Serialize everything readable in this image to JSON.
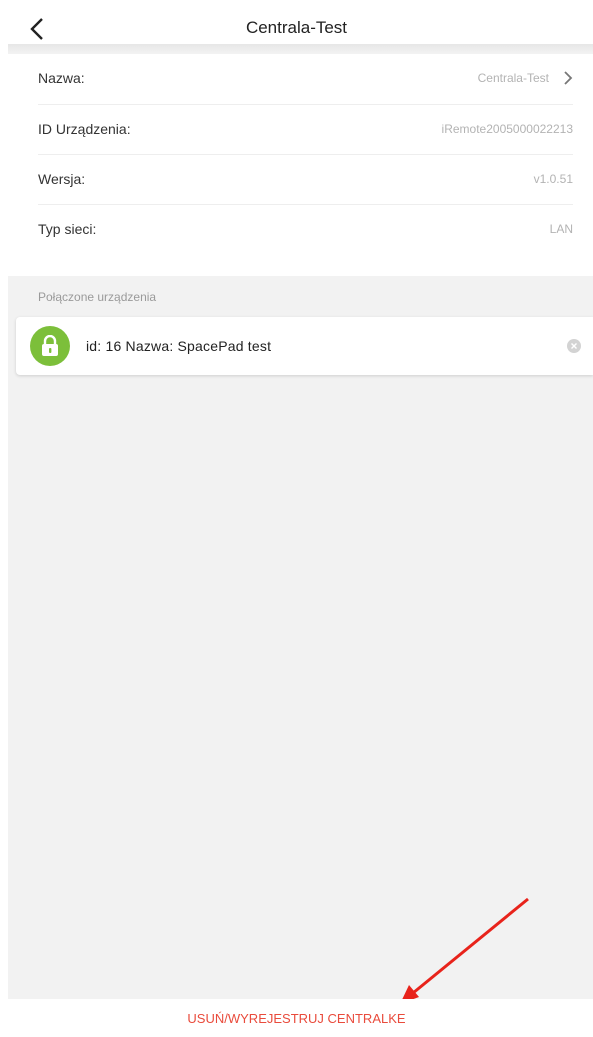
{
  "header": {
    "title": "Centrala-Test"
  },
  "info": [
    {
      "label": "Nazwa:",
      "value": "Centrala-Test",
      "has_chevron": true
    },
    {
      "label": "ID Urządzenia:",
      "value": "iRemote2005000022213"
    },
    {
      "label": "Wersja:",
      "value": "v1.0.51"
    },
    {
      "label": "Typ sieci:",
      "value": "LAN"
    }
  ],
  "connected": {
    "section_label": "Połączone urządzenia",
    "device": {
      "text": "id: 16 Nazwa: SpacePad test",
      "icon": "lock-icon"
    }
  },
  "footer": {
    "action_label": "USUŃ/WYREJESTRUJ CENTRALKE"
  },
  "colors": {
    "accent_green": "#7cbf3a",
    "danger_red": "#e94b3c",
    "annotation_arrow": "#e8231b"
  }
}
